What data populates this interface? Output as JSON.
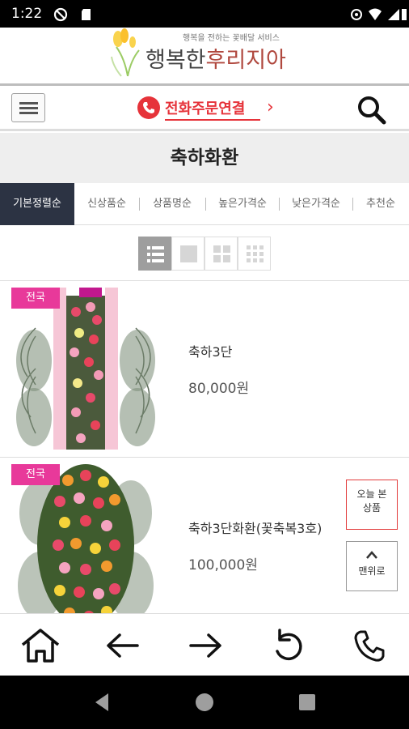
{
  "status_bar": {
    "time": "1:22"
  },
  "header": {
    "tagline": "행복을 전하는 꽃배달 서비스",
    "brand_part1": "행복한",
    "brand_part2": "후리지아"
  },
  "toolbar": {
    "phone_order_label": "전화주문연결",
    "arrow": "›"
  },
  "page": {
    "title": "축하화환"
  },
  "sort_tabs": [
    {
      "label": "기본정렬순",
      "active": true
    },
    {
      "label": "신상품순",
      "active": false
    },
    {
      "label": "상품명순",
      "active": false
    },
    {
      "label": "높은가격순",
      "active": false
    },
    {
      "label": "낮은가격순",
      "active": false
    },
    {
      "label": "추천순",
      "active": false
    }
  ],
  "view_modes": [
    "list",
    "single",
    "grid-2",
    "grid-3"
  ],
  "products": [
    {
      "badge": "전국",
      "name": "축하3단",
      "price": "80,000원"
    },
    {
      "badge": "전국",
      "name": "축하3단화환(꽃축복3호)",
      "price": "100,000원"
    }
  ],
  "floating": {
    "recent_line1": "오늘 본",
    "recent_line2": "상품",
    "top_label": "맨위로"
  },
  "bottom_nav": [
    "home-icon",
    "back-arrow-icon",
    "forward-arrow-icon",
    "refresh-icon",
    "phone-icon"
  ],
  "colors": {
    "accent_red": "#e6333a",
    "badge_pink": "#e8399a",
    "active_tab": "#2c3343"
  }
}
